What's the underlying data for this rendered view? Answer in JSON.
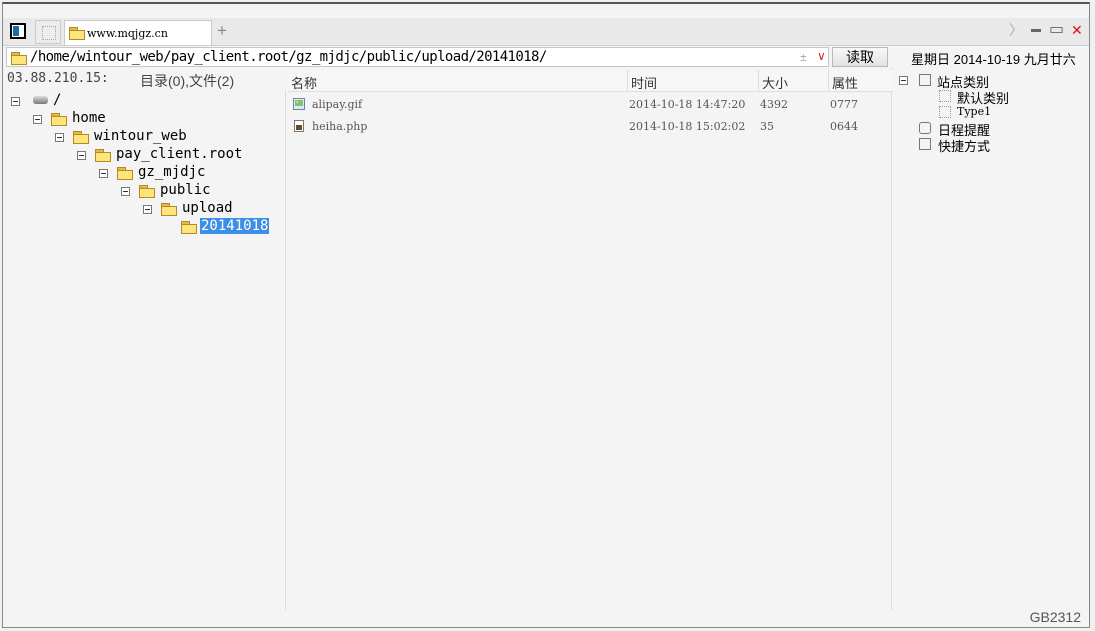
{
  "tab": {
    "title": "www.mqjgz.cn",
    "add": "+"
  },
  "window": {
    "next": "〉",
    "min": "▬",
    "max": "▭",
    "close": "✕"
  },
  "address": {
    "path": "/home/wintour_web/pay_client.root/gz_mjdjc/public/upload/20141018/",
    "pm": "±",
    "dropdown": "∨",
    "read_button": "读取"
  },
  "date_text": "星期日 2014-10-19 九月廿六",
  "left_panel": {
    "ip": "03.88.210.15:",
    "counts": "目录(0),文件(2)",
    "tree": [
      "/",
      "home",
      "wintour_web",
      "pay_client.root",
      "gz_mjdjc",
      "public",
      "upload",
      "20141018"
    ]
  },
  "file_list": {
    "columns": [
      "名称",
      "时间",
      "大小",
      "属性"
    ],
    "rows": [
      {
        "name": "alipay.gif",
        "time": "2014-10-18 14:47:20",
        "size": "4392",
        "attr": "0777"
      },
      {
        "name": "heiha.php",
        "time": "2014-10-18 15:02:02",
        "size": "35",
        "attr": "0644"
      }
    ]
  },
  "right_panel": {
    "site_category": "站点类别",
    "default_category": "默认类别",
    "type1": "Type1",
    "schedule": "日程提醒",
    "shortcuts": "快捷方式"
  },
  "status": {
    "encoding": "GB2312"
  }
}
